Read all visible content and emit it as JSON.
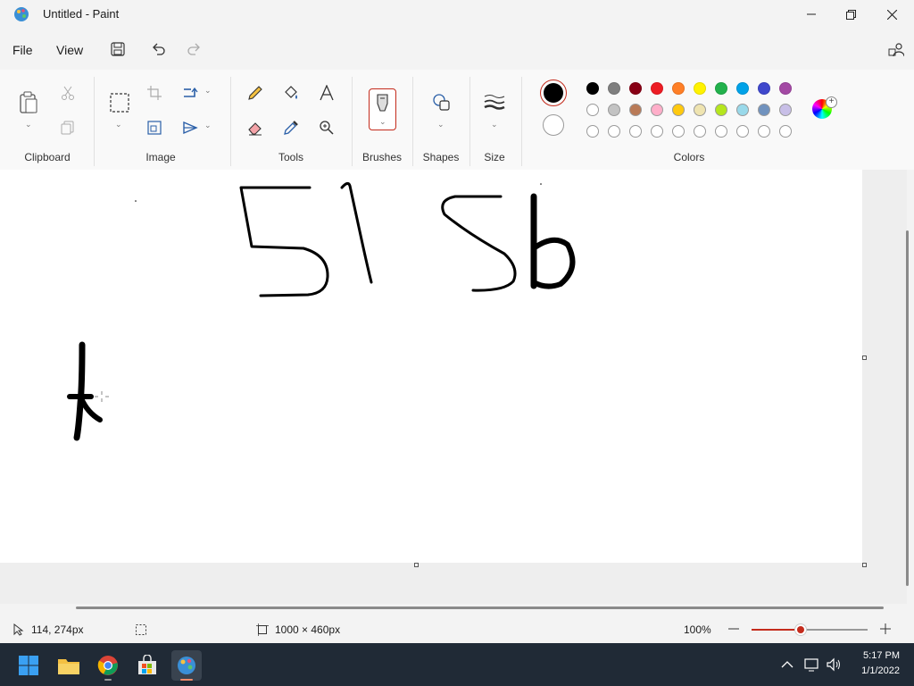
{
  "window": {
    "title": "Untitled - Paint"
  },
  "menu": {
    "file": "File",
    "view": "View"
  },
  "ribbon": {
    "groups": {
      "clipboard": "Clipboard",
      "image": "Image",
      "tools": "Tools",
      "brushes": "Brushes",
      "shapes": "Shapes",
      "size": "Size",
      "colors": "Colors"
    }
  },
  "colors": {
    "primary": "#000000",
    "secondary": "#ffffff",
    "palette_row1": [
      "#000000",
      "#7f7f7f",
      "#880015",
      "#ed1c24",
      "#ff7f27",
      "#fff200",
      "#22b14c",
      "#00a2e8",
      "#3f48cc",
      "#a349a4"
    ],
    "palette_row2": [
      "#ffffff",
      "#c3c3c3",
      "#b97a57",
      "#ffaec9",
      "#ffc90e",
      "#efe4b0",
      "#b5e61d",
      "#99d9ea",
      "#7092be",
      "#c8bfe7"
    ],
    "palette_row3": [
      "#ffffff",
      "#ffffff",
      "#ffffff",
      "#ffffff",
      "#ffffff",
      "#ffffff",
      "#ffffff",
      "#ffffff",
      "#ffffff",
      "#ffffff"
    ],
    "accent": "#c42b1c"
  },
  "status": {
    "cursor_position": "114, 274px",
    "canvas_size": "1000 × 460px",
    "zoom": "100%",
    "zoom_fraction": 0.42
  },
  "taskbar": {
    "time": "5:17 PM",
    "date": "1/1/2022"
  }
}
